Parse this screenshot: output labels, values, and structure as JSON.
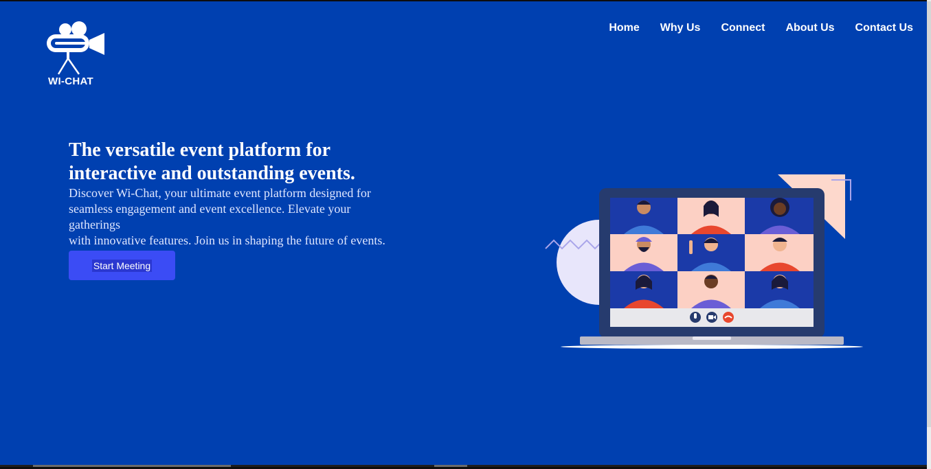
{
  "brand": {
    "name": "WI-CHAT",
    "logo_icon": "movie-camera-icon"
  },
  "nav": {
    "items": [
      {
        "label": "Home"
      },
      {
        "label": "Why Us"
      },
      {
        "label": "Connect"
      },
      {
        "label": "About Us"
      },
      {
        "label": "Contact Us"
      }
    ]
  },
  "hero": {
    "title": "The versatile event platform for interactive and outstanding events.",
    "description_lines": [
      "Discover Wi-Chat, your ultimate event platform designed for",
      "seamless engagement and event excellence. Elevate your",
      "gatherings",
      "with innovative features. Join us in shaping the future of events."
    ],
    "cta_label": "Start Meeting"
  },
  "illustration": {
    "subject": "video-conference-laptop",
    "controls": [
      "microphone-icon",
      "video-camera-icon",
      "hang-up-icon"
    ]
  },
  "colors": {
    "background": "#0040b0",
    "cta": "#3b4cf5",
    "tile_peach": "#fcd0c4",
    "tile_blue": "#1b3aa8"
  }
}
